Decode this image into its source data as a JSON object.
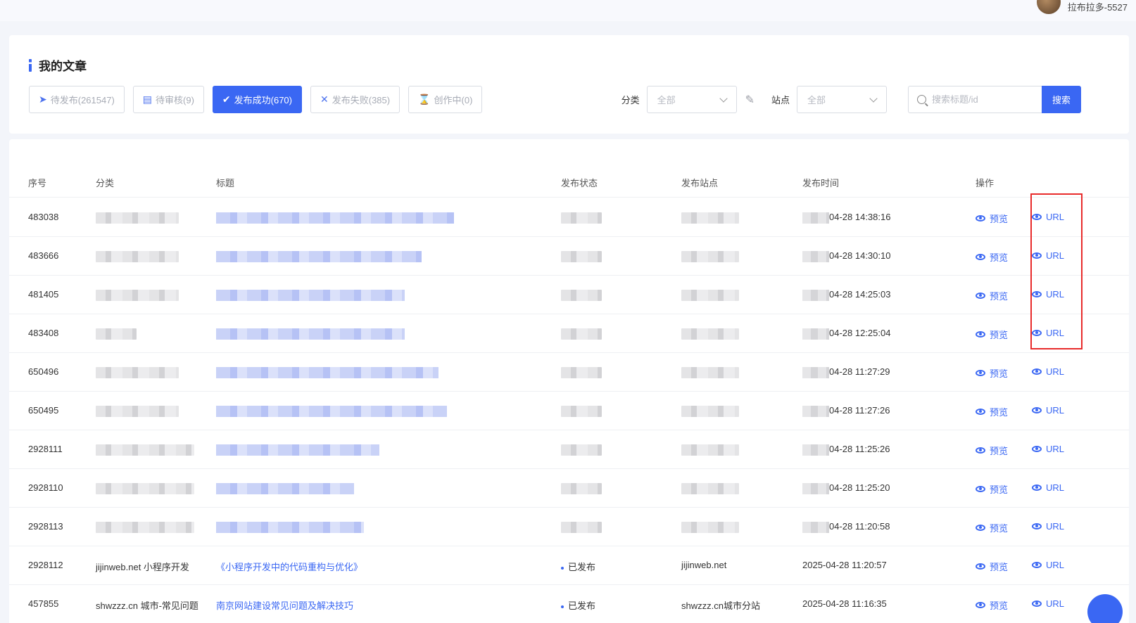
{
  "user": {
    "name": "拉布拉多-5527"
  },
  "header": {
    "title": "我的文章"
  },
  "tabs": [
    {
      "label": "待发布(261547)",
      "icon": "send-icon"
    },
    {
      "label": "待审核(9)",
      "icon": "review-icon"
    },
    {
      "label": "发布成功(670)",
      "icon": "check-icon"
    },
    {
      "label": "发布失败(385)",
      "icon": "cross-icon"
    },
    {
      "label": "创作中(0)",
      "icon": "hourglass-icon"
    }
  ],
  "filters": {
    "category_label": "分类",
    "category_value": "全部",
    "site_label": "站点",
    "site_value": "全部",
    "search_placeholder": "搜索标题/id",
    "search_button": "搜索"
  },
  "table": {
    "columns": [
      "序号",
      "分类",
      "标题",
      "发布状态",
      "发布站点",
      "发布时间",
      "操作"
    ],
    "preview_label": "预览",
    "url_label": "URL",
    "rows": [
      {
        "id": "483038",
        "time": "04-28 14:38:16"
      },
      {
        "id": "483666",
        "time": "04-28 14:30:10"
      },
      {
        "id": "481405",
        "time": "04-28 14:25:03"
      },
      {
        "id": "483408",
        "time": "04-28 12:25:04"
      },
      {
        "id": "650496",
        "time": "04-28 11:27:29"
      },
      {
        "id": "650495",
        "time": "04-28 11:27:26"
      },
      {
        "id": "2928111",
        "time": "04-28 11:25:26"
      },
      {
        "id": "2928110",
        "time": "04-28 11:25:20"
      },
      {
        "id": "2928113",
        "time": "04-28 11:20:58"
      },
      {
        "id": "2928112",
        "category": "jijinweb.net 小程序开发",
        "title": "《小程序开发中的代码重构与优化》",
        "status": "已发布",
        "site": "jijinweb.net",
        "time": "2025-04-28 11:20:57"
      },
      {
        "id": "457855",
        "category": "shwzzz.cn 城市-常见问题",
        "title": "南京网站建设常见问题及解决技巧",
        "status": "已发布",
        "site": "shwzzz.cn城市分站",
        "time": "2025-04-28 11:16:35"
      }
    ]
  }
}
